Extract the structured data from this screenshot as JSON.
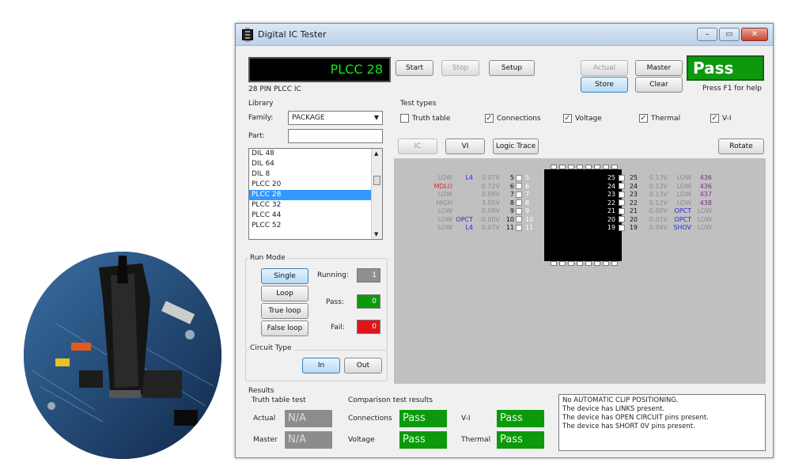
{
  "window": {
    "title": "Digital IC Tester",
    "min_glyph": "–",
    "max_glyph": "▭",
    "close_glyph": "✕"
  },
  "header": {
    "lcd_text": "PLCC 28",
    "device_description": "28 PIN PLCC IC",
    "start_label": "Start",
    "stop_label": "Stop",
    "setup_label": "Setup",
    "actual_label": "Actual",
    "master_label": "Master",
    "store_label": "Store",
    "clear_label": "Clear",
    "status_text": "Pass",
    "help_text": "Press F1 for help"
  },
  "library": {
    "title": "Library",
    "family_label": "Family:",
    "family_value": "PACKAGE",
    "part_label": "Part:",
    "part_value": "",
    "items": [
      "DIL 48",
      "DIL 64",
      "DIL 8",
      "PLCC 20",
      "PLCC 28",
      "PLCC 32",
      "PLCC 44",
      "PLCC 52"
    ],
    "selected": "PLCC 28"
  },
  "test_types": {
    "title": "Test types",
    "items": [
      {
        "label": "Truth table",
        "checked": false
      },
      {
        "label": "Connections",
        "checked": true
      },
      {
        "label": "Voltage",
        "checked": true
      },
      {
        "label": "Thermal",
        "checked": true
      },
      {
        "label": "V-I",
        "checked": true
      }
    ]
  },
  "view_tabs": {
    "ic": "IC",
    "vi": "VI",
    "logic_trace": "Logic Trace",
    "rotate": "Rotate"
  },
  "pins_left": [
    {
      "state": "LOW",
      "state2": "L4",
      "voltage": "0.07V",
      "num": "5",
      "inner": "5"
    },
    {
      "state": "MDLO",
      "state2": "",
      "voltage": "0.72V",
      "num": "6",
      "inner": "6"
    },
    {
      "state": "LOW",
      "state2": "",
      "voltage": "0.09V",
      "num": "7",
      "inner": "7"
    },
    {
      "state": "HIGH",
      "state2": "",
      "voltage": "3.05V",
      "num": "8",
      "inner": "8"
    },
    {
      "state": "LOW",
      "state2": "",
      "voltage": "0.08V",
      "num": "9",
      "inner": "9"
    },
    {
      "state": "LOW",
      "state2": "OPCT",
      "voltage": "-0.00V",
      "num": "10",
      "inner": "10"
    },
    {
      "state": "LOW",
      "state2": "L4",
      "voltage": "0.07V",
      "num": "11",
      "inner": "11"
    }
  ],
  "pins_right": [
    {
      "inner": "25",
      "num": "25",
      "voltage": "0.13V",
      "state": "LOW",
      "extra": "436"
    },
    {
      "inner": "24",
      "num": "24",
      "voltage": "0.13V",
      "state": "LOW",
      "extra": "436"
    },
    {
      "inner": "23",
      "num": "23",
      "voltage": "0.13V",
      "state": "LOW",
      "extra": "437"
    },
    {
      "inner": "22",
      "num": "22",
      "voltage": "0.12V",
      "state": "LOW",
      "extra": "438"
    },
    {
      "inner": "21",
      "num": "21",
      "voltage": "-0.00V",
      "state": "OPCT",
      "extra": "LOW"
    },
    {
      "inner": "20",
      "num": "20",
      "voltage": "-0.01V",
      "state": "OPCT",
      "extra": "LOW"
    },
    {
      "inner": "19",
      "num": "19",
      "voltage": "0.04V",
      "state": "SHOV",
      "extra": "LOW"
    }
  ],
  "run_mode": {
    "title": "Run Mode",
    "single": "Single",
    "loop": "Loop",
    "true_loop": "True loop",
    "false_loop": "False loop",
    "running_label": "Running:",
    "running_value": "1",
    "pass_label": "Pass:",
    "pass_value": "0",
    "fail_label": "Fail:",
    "fail_value": "0"
  },
  "circuit_type": {
    "title": "Circuit Type",
    "in": "In",
    "out": "Out"
  },
  "results": {
    "title": "Results",
    "truth_title": "Truth table test",
    "comparison_title": "Comparison test results",
    "actual_label": "Actual",
    "actual_value": "N/A",
    "master_label": "Master",
    "master_value": "N/A",
    "connections_label": "Connections",
    "connections_value": "Pass",
    "vi_label": "V-I",
    "vi_value": "Pass",
    "voltage_label": "Voltage",
    "voltage_value": "Pass",
    "thermal_label": "Thermal",
    "thermal_value": "Pass",
    "messages": [
      "No AUTOMATIC CLIP POSITIONING.",
      "The device has LINKS present.",
      "The device has OPEN CIRCUIT pins present.",
      "The device has SHORT 0V pins present."
    ]
  },
  "colors": {
    "pass_green": "#0c9a0c",
    "fail_red": "#e0151a",
    "selection_blue": "#3399ff",
    "lcd_green": "#12e812",
    "state_blue": "#2b2be0",
    "state_red": "#e02b2b",
    "extra_purple": "#7a2b8f"
  }
}
